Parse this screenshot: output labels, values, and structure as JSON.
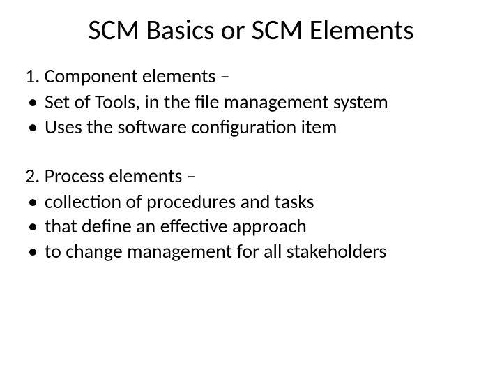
{
  "title": "SCM Basics or SCM Elements",
  "section1": {
    "heading": "1. Component elements –",
    "items": [
      "Set of Tools, in the file management system",
      "Uses the software configuration item"
    ]
  },
  "section2": {
    "heading": "2. Process elements –",
    "items": [
      "collection of procedures and tasks",
      "that define an effective approach",
      "to change management for all stakeholders"
    ]
  }
}
